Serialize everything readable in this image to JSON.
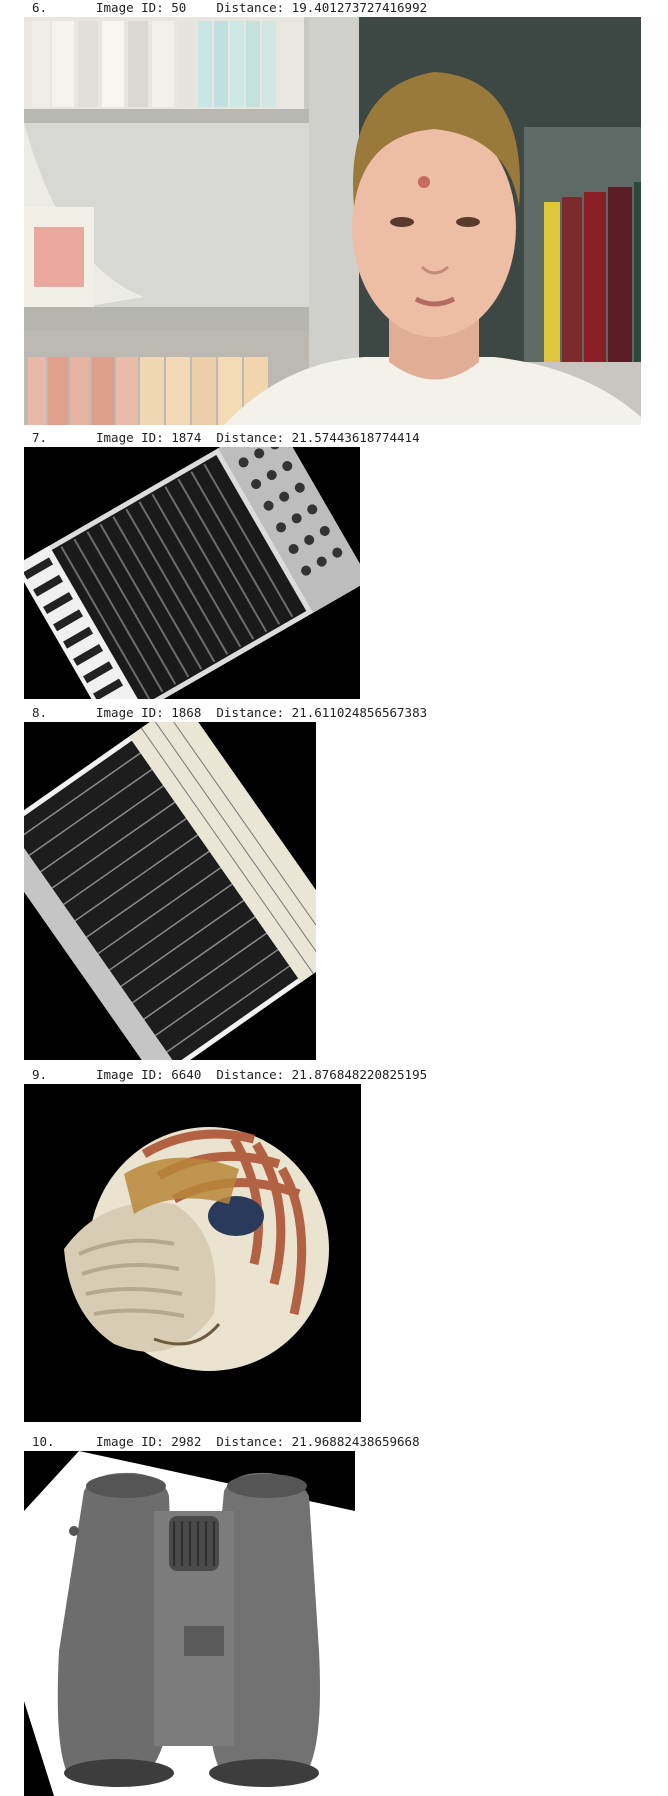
{
  "results": [
    {
      "rank": "6.",
      "meta": "Image ID: 50    Distance: 19.401273727416992"
    },
    {
      "rank": "7.",
      "meta": "Image ID: 1874  Distance: 21.57443618774414"
    },
    {
      "rank": "8.",
      "meta": "Image ID: 1868  Distance: 21.611024856567383"
    },
    {
      "rank": "9.",
      "meta": "Image ID: 6640  Distance: 21.876848220825195"
    },
    {
      "rank": "10.",
      "meta": "Image ID: 2982  Distance: 21.96882438659668"
    }
  ]
}
